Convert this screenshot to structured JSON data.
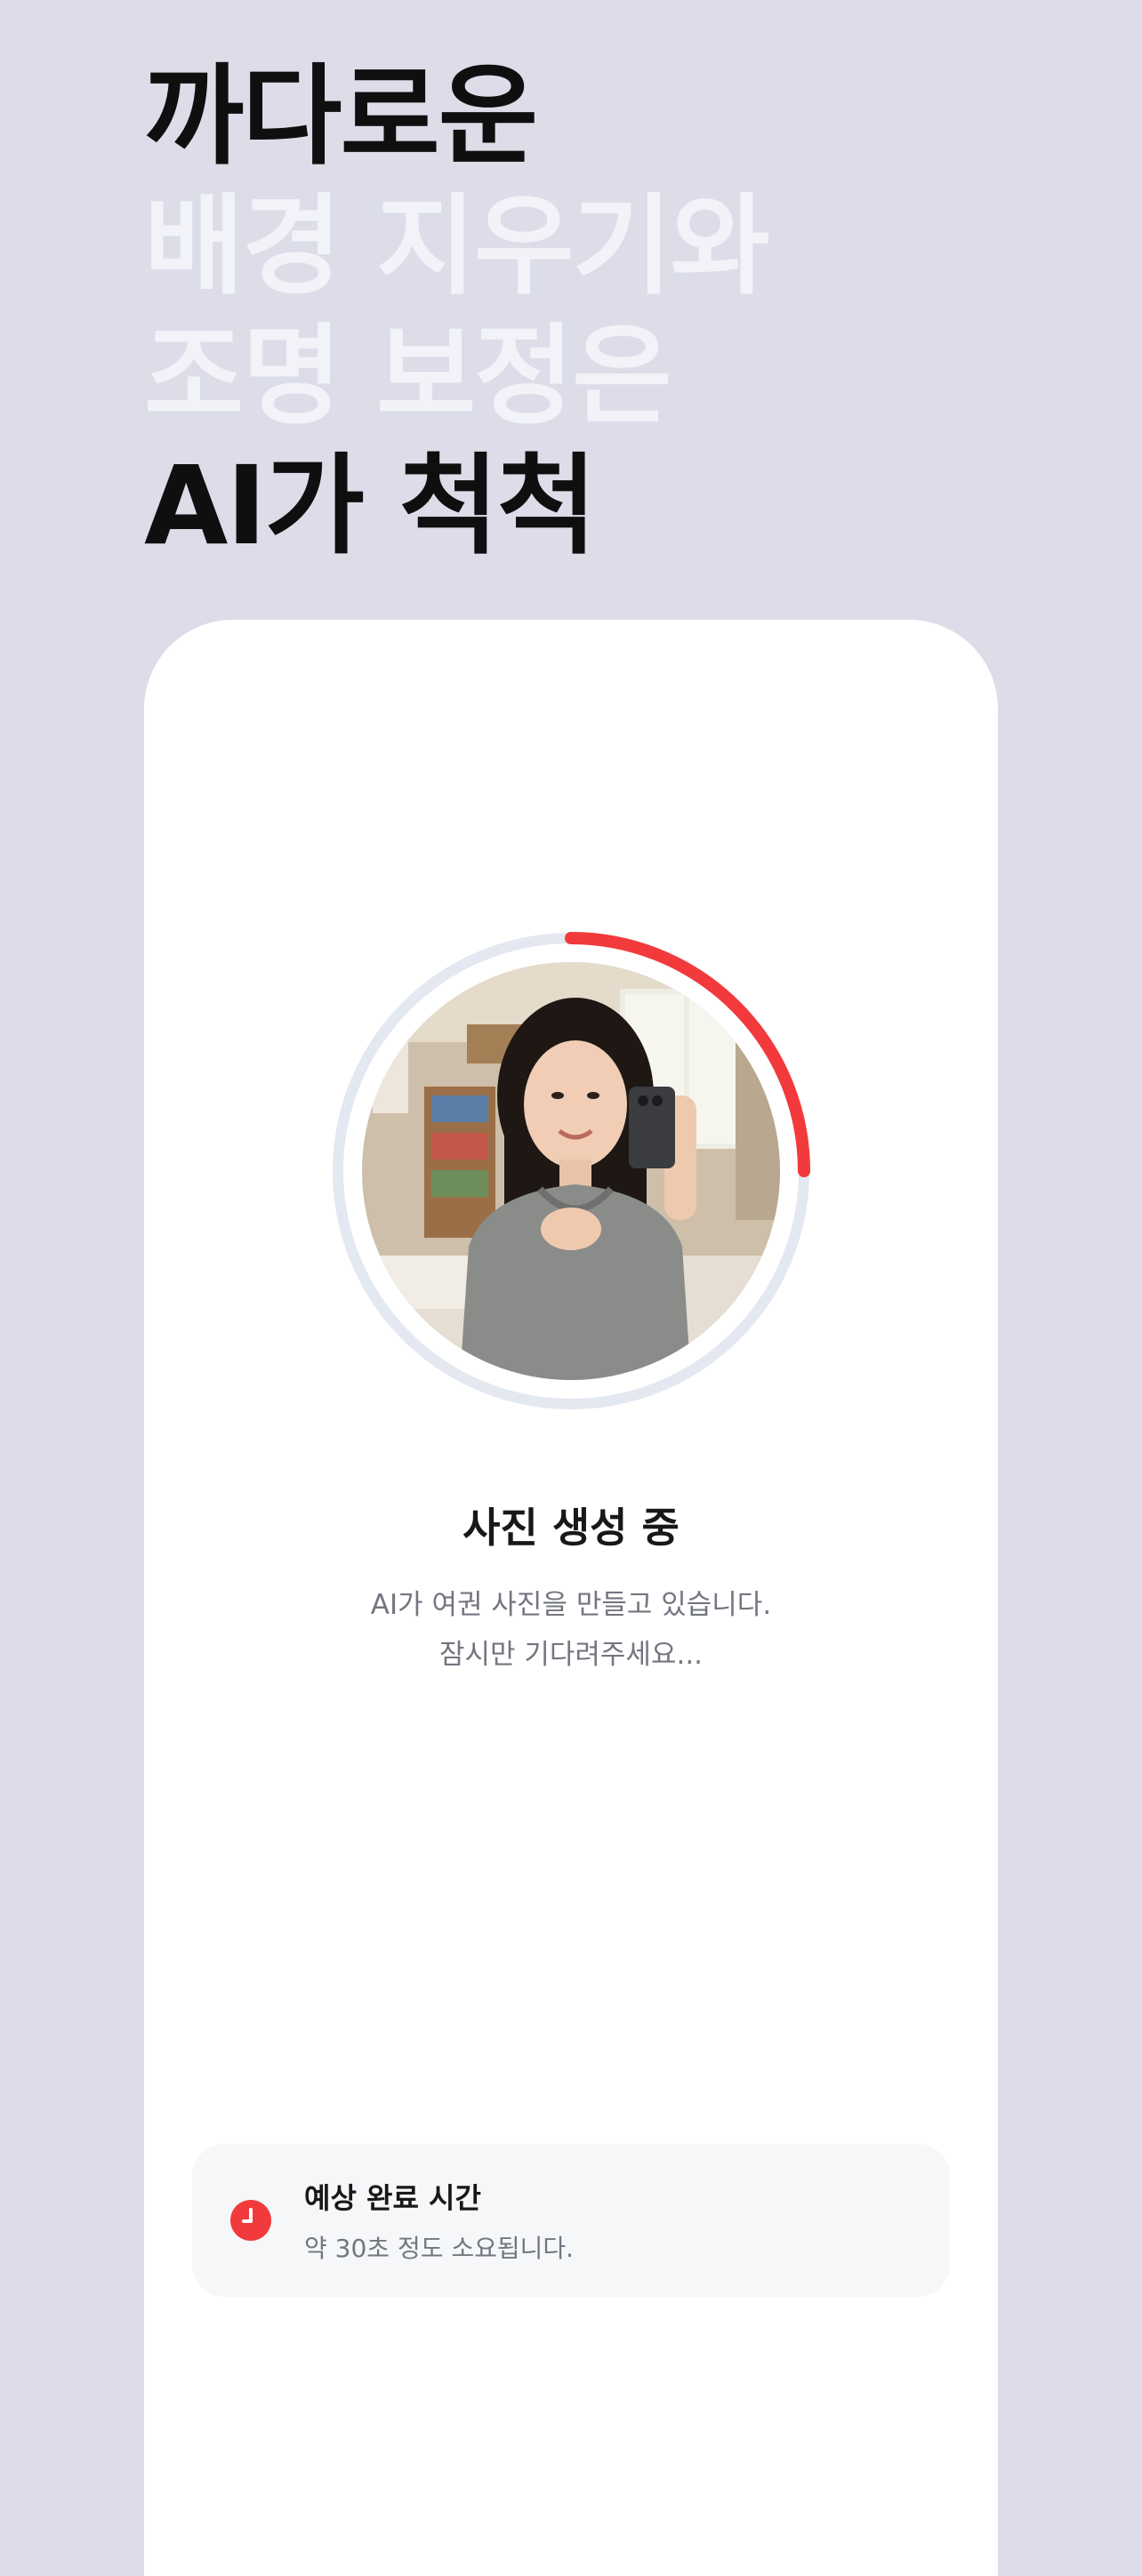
{
  "headline": {
    "line1": "까다로운",
    "line2": "배경 지우기와",
    "line3": "조명 보정은",
    "line4": "AI가 척척"
  },
  "progress": {
    "percent": 25,
    "accent": "#F23A3C",
    "track": "#E3E8F1"
  },
  "status": {
    "title": "사진 생성 중",
    "line1": "AI가 여권 사진을 만들고 있습니다.",
    "line2": "잠시만 기다려주세요..."
  },
  "estimate": {
    "icon": "clock-icon",
    "title": "예상 완료 시간",
    "subtitle": "약 30초 정도 소요됩니다."
  }
}
